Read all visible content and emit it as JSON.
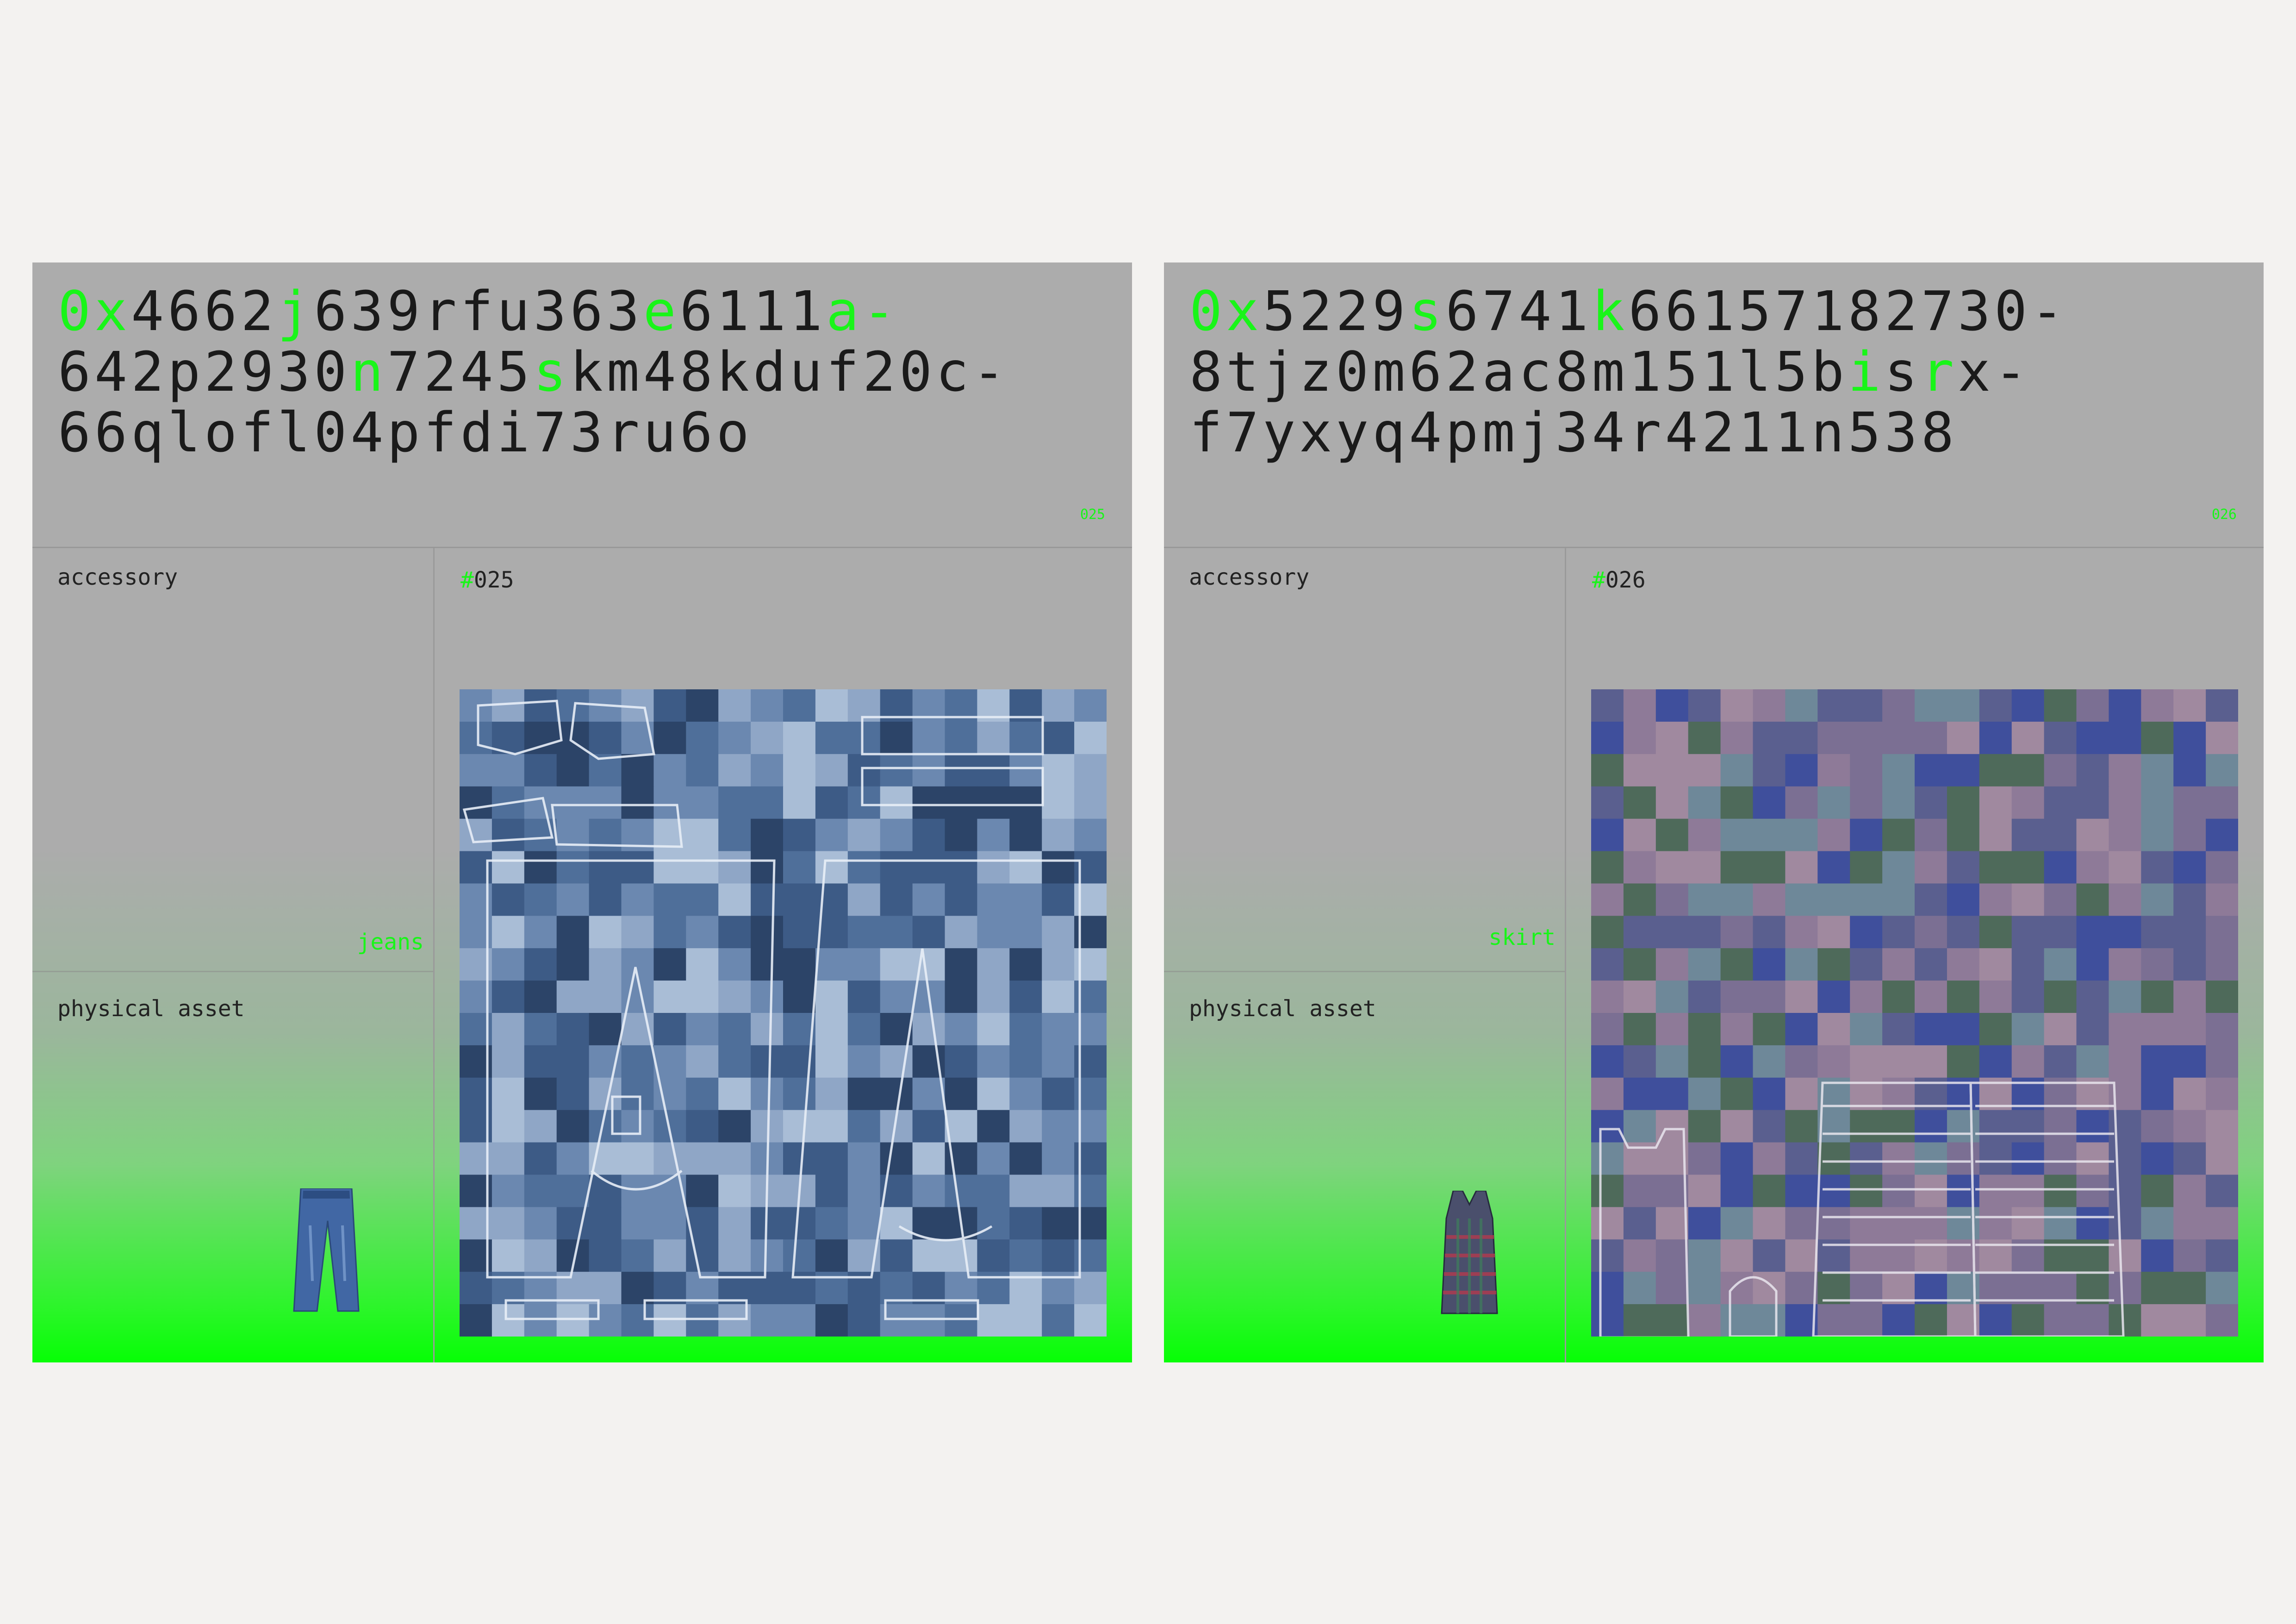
{
  "cards": [
    {
      "hash_lines": [
        [
          {
            "t": "0x",
            "g": true
          },
          {
            "t": "4662",
            "g": false
          },
          {
            "t": "j",
            "g": true
          },
          {
            "t": "639rfu363",
            "g": false
          },
          {
            "t": "e",
            "g": true
          },
          {
            "t": "6111",
            "g": false
          },
          {
            "t": "a-",
            "g": true
          }
        ],
        [
          {
            "t": "642p2930",
            "g": false
          },
          {
            "t": "n",
            "g": true
          },
          {
            "t": "7245",
            "g": false
          },
          {
            "t": "s",
            "g": true
          },
          {
            "t": "km48kduf20c-",
            "g": false
          }
        ],
        [
          {
            "t": "66qlofl04pfdi73ru6o",
            "g": false
          }
        ]
      ],
      "small_number": "025",
      "category_label": "accessory",
      "type_tag": "jeans",
      "asset_label": "physical asset",
      "item_number": "025",
      "number_prefix": "#",
      "thumbnail_icon": "jeans-icon",
      "texture_palette": [
        "#3d5b86",
        "#4f6f9a",
        "#6b88b0",
        "#8fa6c6",
        "#a9bdd6",
        "#2c4468"
      ]
    },
    {
      "hash_lines": [
        [
          {
            "t": "0x",
            "g": true
          },
          {
            "t": "5229",
            "g": false
          },
          {
            "t": "s",
            "g": true
          },
          {
            "t": "6741",
            "g": false
          },
          {
            "t": "k",
            "g": true
          },
          {
            "t": "66157182730-",
            "g": false
          }
        ],
        [
          {
            "t": "8tjz0m62ac8m151l5b",
            "g": false
          },
          {
            "t": "i",
            "g": true
          },
          {
            "t": "s",
            "g": false
          },
          {
            "t": "r",
            "g": true
          },
          {
            "t": "x-",
            "g": false
          }
        ],
        [
          {
            "t": "f7yxyq4pmj34r4211n538",
            "g": false
          }
        ]
      ],
      "small_number": "026",
      "category_label": "accessory",
      "type_tag": "skirt",
      "asset_label": "physical asset",
      "item_number": "026",
      "number_prefix": "#",
      "thumbnail_icon": "dress-icon",
      "texture_palette": [
        "#5a5f8f",
        "#7b6f93",
        "#8e7a98",
        "#3f4f9c",
        "#4e6a5a",
        "#a0899f",
        "#6e8899"
      ]
    }
  ],
  "colors": {
    "accent": "#19f519",
    "card_gray": "#acacac",
    "page_bg": "#f3f2f0"
  }
}
